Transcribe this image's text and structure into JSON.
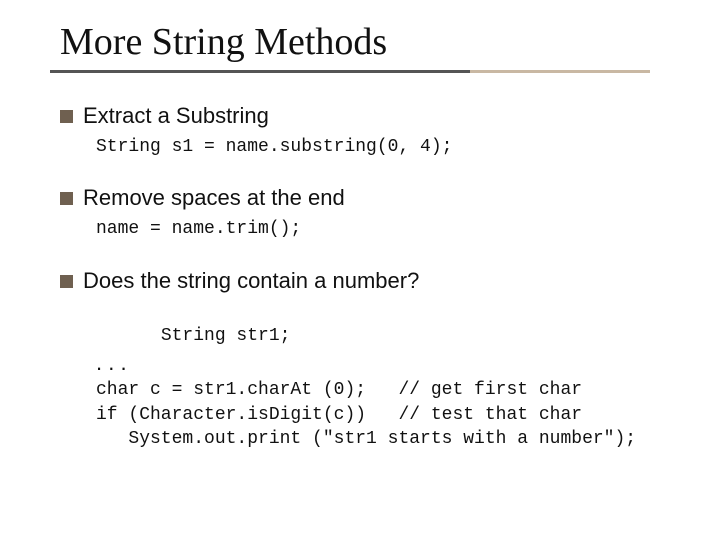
{
  "title": "More String Methods",
  "bullets": [
    {
      "text": "Extract a Substring",
      "code": "String s1 = name.substring(0, 4);"
    },
    {
      "text": "Remove spaces at the end",
      "code": "name = name.trim();"
    },
    {
      "text": "Does the string contain a number?",
      "code_lines": [
        "String str1;",
        ". . .",
        "char c = str1.charAt (0);   // get first char",
        "if (Character.isDigit(c))   // test that char",
        "   System.out.print (\"str1 starts with a number\");"
      ]
    }
  ]
}
